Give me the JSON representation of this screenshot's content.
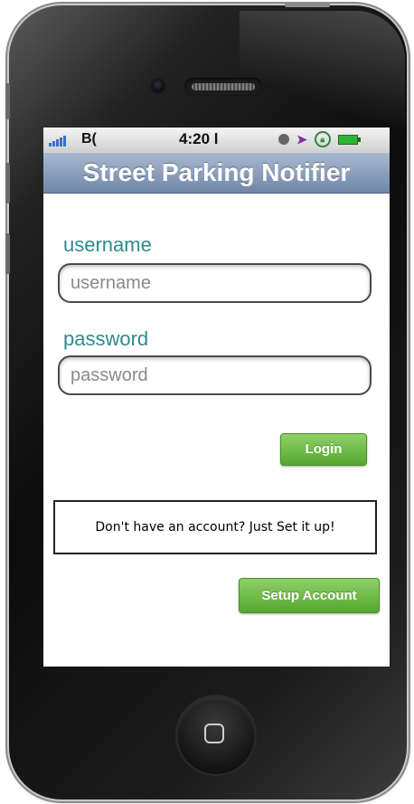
{
  "status_bar": {
    "carrier": "B(",
    "time": "4:20 l",
    "icons": [
      "signal-icon",
      "alarm-icon",
      "location-arrow-icon",
      "rotation-lock-icon",
      "battery-icon"
    ]
  },
  "nav": {
    "title": "Street Parking Notifier"
  },
  "form": {
    "username_label": "username",
    "username_placeholder": "username",
    "password_label": "password",
    "password_placeholder": "password",
    "login_label": "Login"
  },
  "signup": {
    "note": "Don't have an account? Just Set it up!",
    "setup_label": "Setup Account"
  },
  "colors": {
    "label_teal": "#2d8a8e",
    "button_green": "#56a72e",
    "nav_blue": "#6f86a8"
  }
}
